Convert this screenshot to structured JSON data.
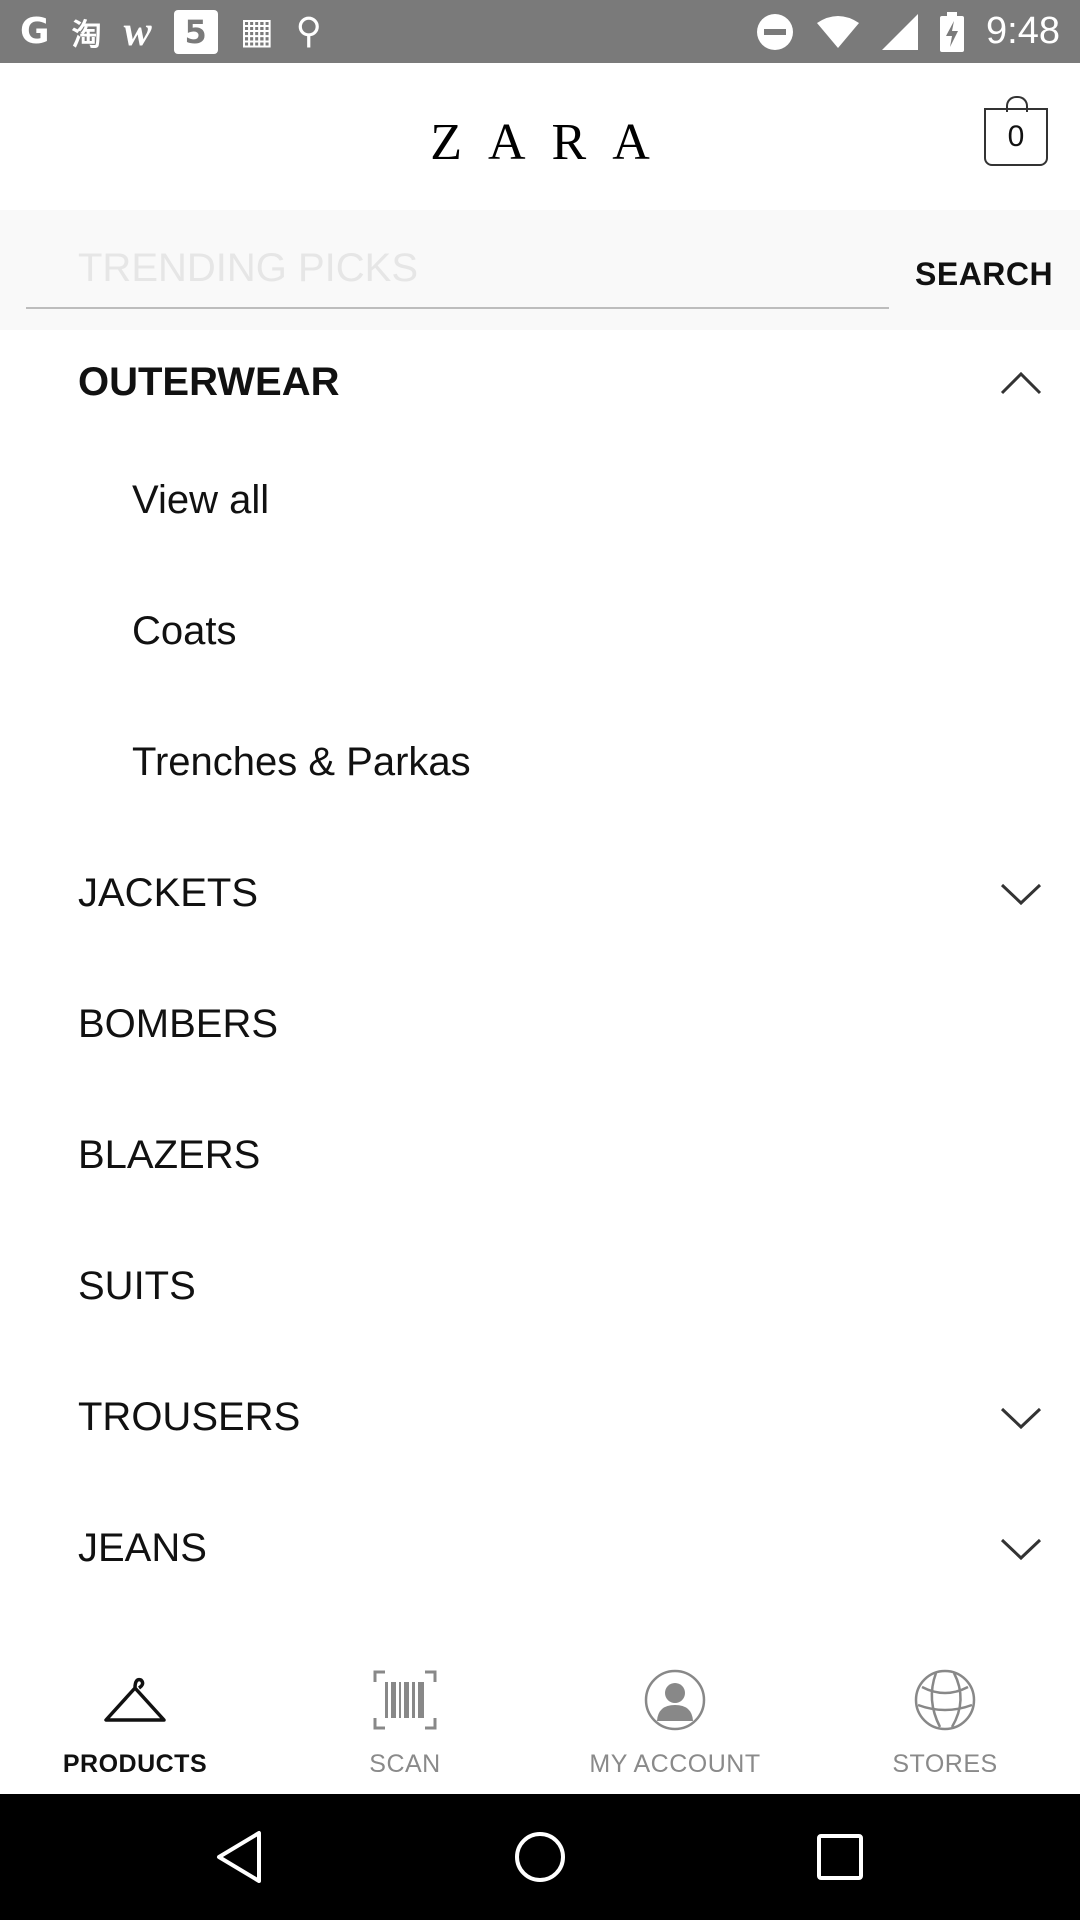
{
  "status_bar": {
    "icons_left": [
      "google-g-icon",
      "taobao-icon",
      "wish-w-icon",
      "five-icon",
      "grid-icon",
      "link-icon"
    ],
    "glyphs": [
      "G",
      "淘",
      "w",
      "5",
      "▦",
      "⚲"
    ],
    "icons_right": [
      "do-not-disturb-icon",
      "wifi-icon",
      "signal-icon",
      "battery-charging-icon"
    ],
    "time": "9:48"
  },
  "header": {
    "logo": "ZARA",
    "cart_count": "0"
  },
  "search": {
    "placeholder": "TRENDING PICKS",
    "button_label": "SEARCH"
  },
  "menu": {
    "category": "OUTERWEAR",
    "subitems": [
      "View all",
      "Coats",
      "Trenches & Parkas"
    ],
    "items": [
      {
        "label": "JACKETS",
        "expandable": true
      },
      {
        "label": "BOMBERS",
        "expandable": false
      },
      {
        "label": "BLAZERS",
        "expandable": false
      },
      {
        "label": "SUITS",
        "expandable": false
      },
      {
        "label": "TROUSERS",
        "expandable": true
      },
      {
        "label": "JEANS",
        "expandable": true
      }
    ]
  },
  "bottom_nav": [
    {
      "label": "PRODUCTS",
      "icon": "hanger-icon",
      "active": true
    },
    {
      "label": "SCAN",
      "icon": "barcode-icon",
      "active": false
    },
    {
      "label": "MY ACCOUNT",
      "icon": "account-icon",
      "active": false
    },
    {
      "label": "STORES",
      "icon": "globe-icon",
      "active": false
    }
  ],
  "colors": {
    "status_bar": "#7a7a7a",
    "active_tab": "#111111",
    "inactive_tab": "#8a8a8a",
    "search_bg": "#f9f9f9"
  }
}
